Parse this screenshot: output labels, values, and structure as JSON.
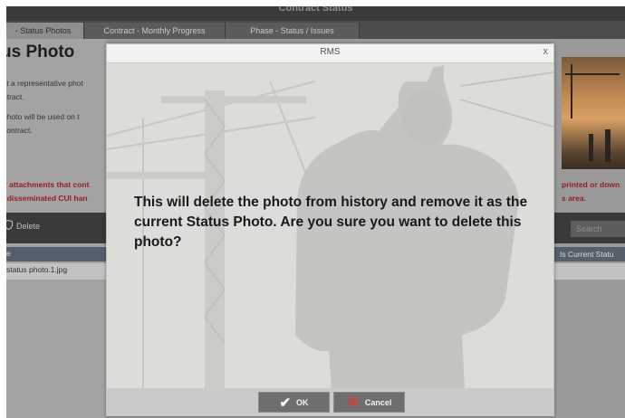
{
  "window": {
    "title": "Contract Status"
  },
  "tabs": [
    {
      "label": "- Status Photos"
    },
    {
      "label": "Contract - Monthly Progress"
    },
    {
      "label": "Phase - Status / Issues"
    }
  ],
  "page": {
    "title": "us Photo",
    "desc_lines": [
      "ct a representative phot",
      "ntract.",
      "photo will be used on t",
      "contract."
    ],
    "warning_left": [
      "y attachments that cont",
      "l disseminated CUI han"
    ],
    "warning_right": [
      "printed or down",
      "s area."
    ]
  },
  "toolbar": {
    "delete_label": "Delete",
    "search_placeholder": "Search"
  },
  "grid": {
    "header_left": "e",
    "header_right": "Is Current Statu",
    "rows": [
      {
        "name": "status photo.1.jpg"
      }
    ]
  },
  "modal": {
    "title": "RMS",
    "close": "x",
    "message": "This will delete the photo from history and remove it as the current Status Photo. Are you sure you want to delete this photo?",
    "ok_label": "OK",
    "cancel_label": "Cancel"
  },
  "icons": {
    "close": "close-icon",
    "ok": "checkmark-icon",
    "cancel": "x-icon",
    "delete": "shield-icon"
  },
  "colors": {
    "warning_text": "#9a1c1c",
    "cancel_icon": "#e23a3a",
    "titlebar": "#3a3a3a"
  }
}
